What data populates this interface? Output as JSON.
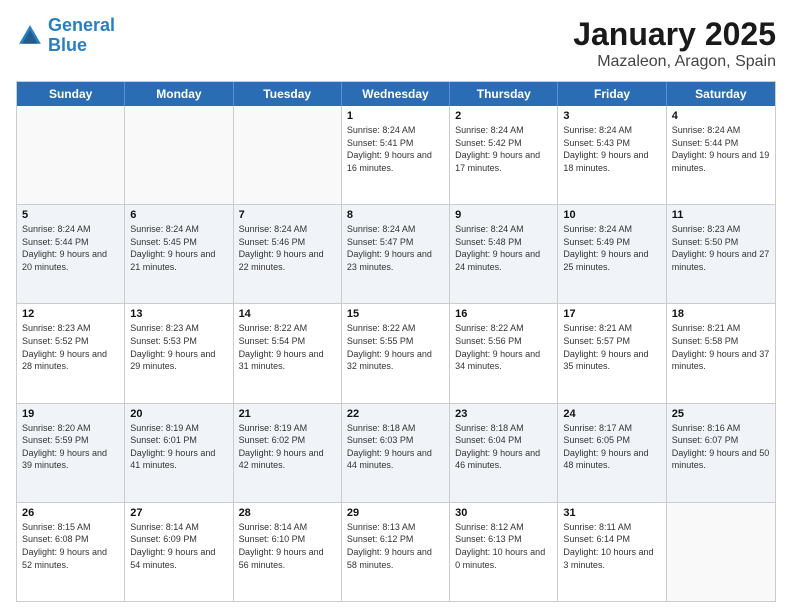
{
  "logo": {
    "line1": "General",
    "line2": "Blue"
  },
  "title": "January 2025",
  "subtitle": "Mazaleon, Aragon, Spain",
  "weekdays": [
    "Sunday",
    "Monday",
    "Tuesday",
    "Wednesday",
    "Thursday",
    "Friday",
    "Saturday"
  ],
  "weeks": [
    [
      {
        "day": "",
        "sunrise": "",
        "sunset": "",
        "daylight": ""
      },
      {
        "day": "",
        "sunrise": "",
        "sunset": "",
        "daylight": ""
      },
      {
        "day": "",
        "sunrise": "",
        "sunset": "",
        "daylight": ""
      },
      {
        "day": "1",
        "sunrise": "Sunrise: 8:24 AM",
        "sunset": "Sunset: 5:41 PM",
        "daylight": "Daylight: 9 hours and 16 minutes."
      },
      {
        "day": "2",
        "sunrise": "Sunrise: 8:24 AM",
        "sunset": "Sunset: 5:42 PM",
        "daylight": "Daylight: 9 hours and 17 minutes."
      },
      {
        "day": "3",
        "sunrise": "Sunrise: 8:24 AM",
        "sunset": "Sunset: 5:43 PM",
        "daylight": "Daylight: 9 hours and 18 minutes."
      },
      {
        "day": "4",
        "sunrise": "Sunrise: 8:24 AM",
        "sunset": "Sunset: 5:44 PM",
        "daylight": "Daylight: 9 hours and 19 minutes."
      }
    ],
    [
      {
        "day": "5",
        "sunrise": "Sunrise: 8:24 AM",
        "sunset": "Sunset: 5:44 PM",
        "daylight": "Daylight: 9 hours and 20 minutes."
      },
      {
        "day": "6",
        "sunrise": "Sunrise: 8:24 AM",
        "sunset": "Sunset: 5:45 PM",
        "daylight": "Daylight: 9 hours and 21 minutes."
      },
      {
        "day": "7",
        "sunrise": "Sunrise: 8:24 AM",
        "sunset": "Sunset: 5:46 PM",
        "daylight": "Daylight: 9 hours and 22 minutes."
      },
      {
        "day": "8",
        "sunrise": "Sunrise: 8:24 AM",
        "sunset": "Sunset: 5:47 PM",
        "daylight": "Daylight: 9 hours and 23 minutes."
      },
      {
        "day": "9",
        "sunrise": "Sunrise: 8:24 AM",
        "sunset": "Sunset: 5:48 PM",
        "daylight": "Daylight: 9 hours and 24 minutes."
      },
      {
        "day": "10",
        "sunrise": "Sunrise: 8:24 AM",
        "sunset": "Sunset: 5:49 PM",
        "daylight": "Daylight: 9 hours and 25 minutes."
      },
      {
        "day": "11",
        "sunrise": "Sunrise: 8:23 AM",
        "sunset": "Sunset: 5:50 PM",
        "daylight": "Daylight: 9 hours and 27 minutes."
      }
    ],
    [
      {
        "day": "12",
        "sunrise": "Sunrise: 8:23 AM",
        "sunset": "Sunset: 5:52 PM",
        "daylight": "Daylight: 9 hours and 28 minutes."
      },
      {
        "day": "13",
        "sunrise": "Sunrise: 8:23 AM",
        "sunset": "Sunset: 5:53 PM",
        "daylight": "Daylight: 9 hours and 29 minutes."
      },
      {
        "day": "14",
        "sunrise": "Sunrise: 8:22 AM",
        "sunset": "Sunset: 5:54 PM",
        "daylight": "Daylight: 9 hours and 31 minutes."
      },
      {
        "day": "15",
        "sunrise": "Sunrise: 8:22 AM",
        "sunset": "Sunset: 5:55 PM",
        "daylight": "Daylight: 9 hours and 32 minutes."
      },
      {
        "day": "16",
        "sunrise": "Sunrise: 8:22 AM",
        "sunset": "Sunset: 5:56 PM",
        "daylight": "Daylight: 9 hours and 34 minutes."
      },
      {
        "day": "17",
        "sunrise": "Sunrise: 8:21 AM",
        "sunset": "Sunset: 5:57 PM",
        "daylight": "Daylight: 9 hours and 35 minutes."
      },
      {
        "day": "18",
        "sunrise": "Sunrise: 8:21 AM",
        "sunset": "Sunset: 5:58 PM",
        "daylight": "Daylight: 9 hours and 37 minutes."
      }
    ],
    [
      {
        "day": "19",
        "sunrise": "Sunrise: 8:20 AM",
        "sunset": "Sunset: 5:59 PM",
        "daylight": "Daylight: 9 hours and 39 minutes."
      },
      {
        "day": "20",
        "sunrise": "Sunrise: 8:19 AM",
        "sunset": "Sunset: 6:01 PM",
        "daylight": "Daylight: 9 hours and 41 minutes."
      },
      {
        "day": "21",
        "sunrise": "Sunrise: 8:19 AM",
        "sunset": "Sunset: 6:02 PM",
        "daylight": "Daylight: 9 hours and 42 minutes."
      },
      {
        "day": "22",
        "sunrise": "Sunrise: 8:18 AM",
        "sunset": "Sunset: 6:03 PM",
        "daylight": "Daylight: 9 hours and 44 minutes."
      },
      {
        "day": "23",
        "sunrise": "Sunrise: 8:18 AM",
        "sunset": "Sunset: 6:04 PM",
        "daylight": "Daylight: 9 hours and 46 minutes."
      },
      {
        "day": "24",
        "sunrise": "Sunrise: 8:17 AM",
        "sunset": "Sunset: 6:05 PM",
        "daylight": "Daylight: 9 hours and 48 minutes."
      },
      {
        "day": "25",
        "sunrise": "Sunrise: 8:16 AM",
        "sunset": "Sunset: 6:07 PM",
        "daylight": "Daylight: 9 hours and 50 minutes."
      }
    ],
    [
      {
        "day": "26",
        "sunrise": "Sunrise: 8:15 AM",
        "sunset": "Sunset: 6:08 PM",
        "daylight": "Daylight: 9 hours and 52 minutes."
      },
      {
        "day": "27",
        "sunrise": "Sunrise: 8:14 AM",
        "sunset": "Sunset: 6:09 PM",
        "daylight": "Daylight: 9 hours and 54 minutes."
      },
      {
        "day": "28",
        "sunrise": "Sunrise: 8:14 AM",
        "sunset": "Sunset: 6:10 PM",
        "daylight": "Daylight: 9 hours and 56 minutes."
      },
      {
        "day": "29",
        "sunrise": "Sunrise: 8:13 AM",
        "sunset": "Sunset: 6:12 PM",
        "daylight": "Daylight: 9 hours and 58 minutes."
      },
      {
        "day": "30",
        "sunrise": "Sunrise: 8:12 AM",
        "sunset": "Sunset: 6:13 PM",
        "daylight": "Daylight: 10 hours and 0 minutes."
      },
      {
        "day": "31",
        "sunrise": "Sunrise: 8:11 AM",
        "sunset": "Sunset: 6:14 PM",
        "daylight": "Daylight: 10 hours and 3 minutes."
      },
      {
        "day": "",
        "sunrise": "",
        "sunset": "",
        "daylight": ""
      }
    ]
  ]
}
